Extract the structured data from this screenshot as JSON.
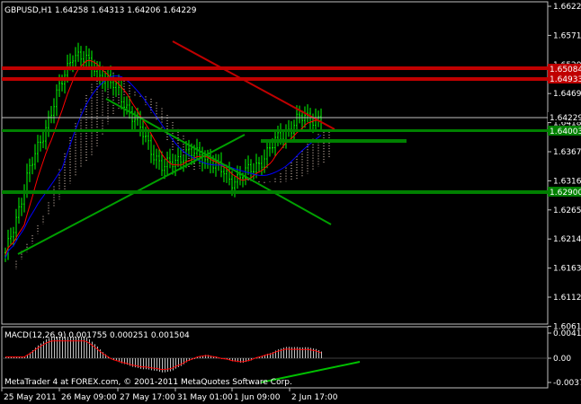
{
  "window": {
    "symbol_label": "GBPUSD,H1",
    "ohlc": "1.64258 1.64313 1.64206 1.64229",
    "copyright": "MetaTrader 4 at FOREX.com, © 2001-2011 MetaQuotes Software Corp."
  },
  "price_axis": {
    "ticks": [
      "1.66220",
      "1.65710",
      "1.65200",
      "1.64690",
      "1.64180",
      "1.63670",
      "1.63160",
      "1.62650",
      "1.62140",
      "1.61630",
      "1.61120",
      "1.60610"
    ],
    "markers": [
      {
        "label": "1.65084",
        "bg": "#c00000",
        "fg": "#ffffff"
      },
      {
        "label": "1.64933",
        "bg": "#c00000",
        "fg": "#ffffff"
      },
      {
        "label": "1.64229",
        "bg": "#000000",
        "fg": "#ffffff"
      },
      {
        "label": "1.64003",
        "bg": "#008000",
        "fg": "#ffffff"
      },
      {
        "label": "1.62900",
        "bg": "#008000",
        "fg": "#ffffff"
      }
    ]
  },
  "macd": {
    "label": "MACD(12,26,9) 0.001755 0.000251 0.001504",
    "ticks": [
      "0.00410",
      "0.00",
      "-0.00378"
    ]
  },
  "time_axis": {
    "ticks": [
      "25 May 2011",
      "26 May 09:00",
      "27 May 17:00",
      "31 May 01:00",
      "1 Jun 09:00",
      "2 Jun 17:00"
    ]
  },
  "colors": {
    "background": "#000000",
    "candles": "#00ff00",
    "resistance": "#c00000",
    "support": "#008000",
    "trendline": "#00a000",
    "ma_fast": "#ff0000",
    "ma_slow": "#0000ff",
    "cloud": "#f0d8c8"
  },
  "chart_data": {
    "type": "candlestick",
    "symbol": "GBPUSD",
    "timeframe": "H1",
    "ylim": [
      1.6061,
      1.6622
    ],
    "x": [
      "25 May 2011",
      "26 May 09:00",
      "27 May 17:00",
      "31 May 01:00",
      "1 Jun 09:00",
      "2 Jun 17:00"
    ],
    "close": [
      1.6175,
      1.632,
      1.643,
      1.654,
      1.651,
      1.647,
      1.64,
      1.633,
      1.636,
      1.635,
      1.631,
      1.633,
      1.638,
      1.642,
      1.6423
    ],
    "horizontal_levels": [
      1.65084,
      1.64933,
      1.64003,
      1.629,
      1.6385
    ]
  }
}
